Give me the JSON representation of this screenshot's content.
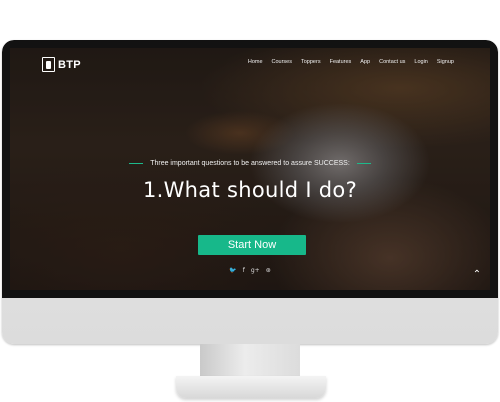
{
  "brand": {
    "name": "BTP"
  },
  "nav": {
    "items": [
      "Home",
      "Courses",
      "Toppers",
      "Features",
      "App",
      "Contact us",
      "Login",
      "Signup"
    ]
  },
  "hero": {
    "tagline": "Three important questions to be answered to assure SUCCESS:",
    "headline": "1.What should I do?",
    "cta_label": "Start Now",
    "social_icons": [
      "twitter-icon",
      "facebook-icon",
      "google-plus-icon",
      "pinterest-icon"
    ],
    "social_glyphs": [
      "🐦",
      "f",
      "g+",
      "⊛"
    ],
    "scroll_top_glyph": "⌃"
  },
  "colors": {
    "accent": "#17b88a",
    "bezel": "#121212"
  }
}
